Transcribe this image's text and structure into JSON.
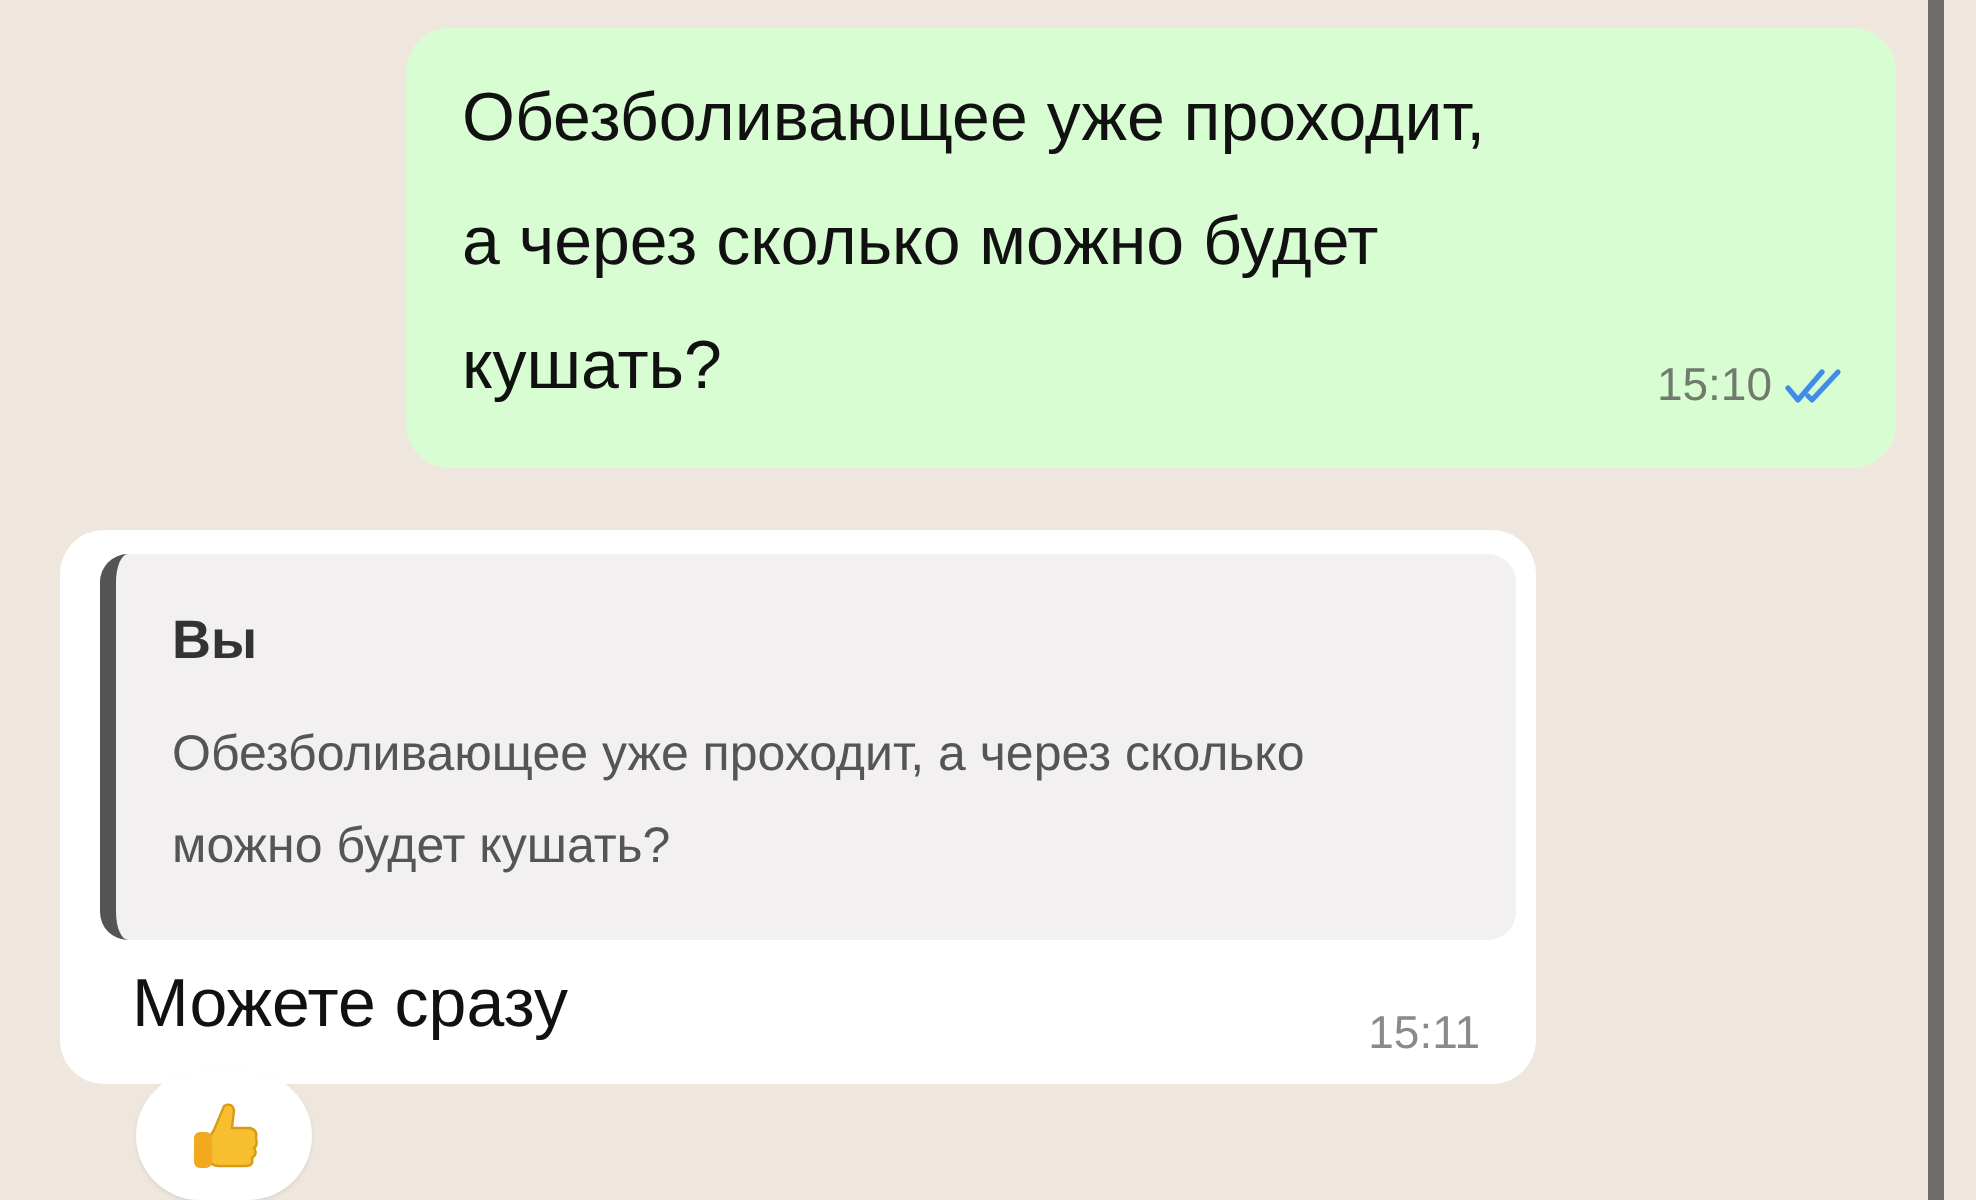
{
  "messages": [
    {
      "kind": "outgoing",
      "text": "Обезболивающее уже проходит, а через сколько можно будет кушать?",
      "time": "15:10",
      "read": true
    },
    {
      "kind": "incoming",
      "quote": {
        "author": "Вы",
        "text": "Обезболивающее уже проходит, а через сколько можно будет кушать?"
      },
      "text": "Можете сразу",
      "time": "15:11",
      "reaction": {
        "kind": "thumbs_up"
      }
    }
  ]
}
